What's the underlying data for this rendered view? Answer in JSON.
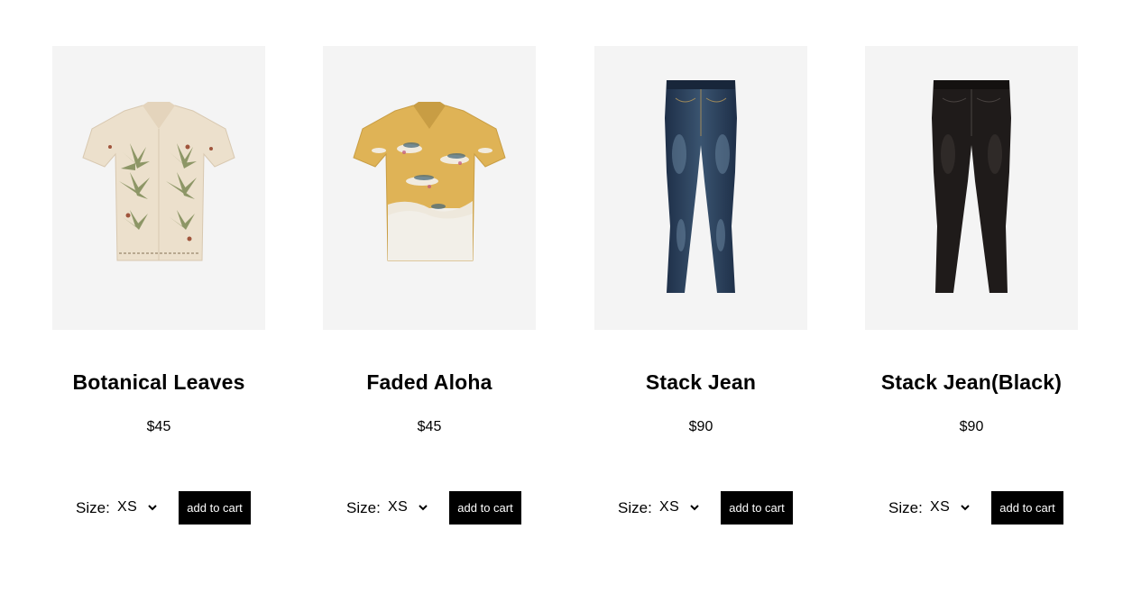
{
  "products": [
    {
      "title": "Botanical Leaves",
      "price": "$45",
      "size_label": "Size:",
      "size_value": "XS",
      "cart_label": "add to cart",
      "image": "botanical-shirt-image"
    },
    {
      "title": "Faded Aloha",
      "price": "$45",
      "size_label": "Size:",
      "size_value": "XS",
      "cart_label": "add to cart",
      "image": "aloha-shirt-image"
    },
    {
      "title": "Stack Jean",
      "price": "$90",
      "size_label": "Size:",
      "size_value": "XS",
      "cart_label": "add to cart",
      "image": "blue-jean-image"
    },
    {
      "title": "Stack Jean(Black)",
      "price": "$90",
      "size_label": "Size:",
      "size_value": "XS",
      "cart_label": "add to cart",
      "image": "black-jean-image"
    }
  ],
  "colors": {
    "image_bg": "#f4f4f4",
    "button_bg": "#000000",
    "button_text": "#ffffff"
  }
}
